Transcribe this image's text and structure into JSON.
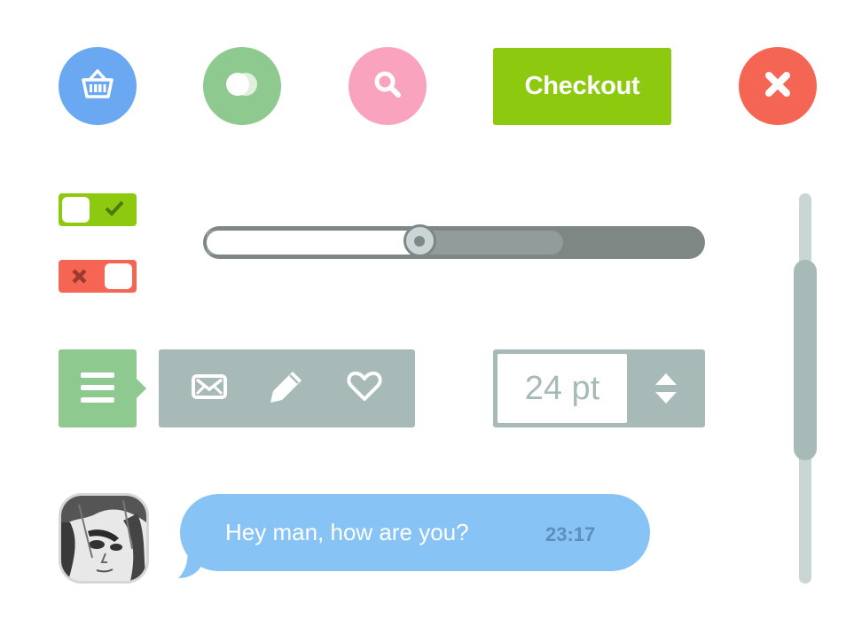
{
  "colors": {
    "blue": "#6aa9f2",
    "green_soft": "#8ec98f",
    "pink": "#f9a3bf",
    "lime": "#8dc90f",
    "red": "#f56554",
    "gray_blue": "#a8bab8",
    "slate": "#7f8785",
    "slate_light": "#929c9a",
    "thumb": "#c9d6d5",
    "bubble": "#88c3f5",
    "bubble_time": "#5b8fbd",
    "stepper_text": "#a8bab8"
  },
  "icons": {
    "basket": "basket-icon",
    "circles": "overlapping-circles-icon",
    "search": "search-icon",
    "close": "close-icon",
    "check": "checkmark-icon",
    "cross": "cross-icon",
    "menu": "hamburger-menu-icon",
    "mail": "envelope-icon",
    "edit": "pencil-icon",
    "like": "heart-icon",
    "stepper": "up-down-arrows-icon"
  },
  "checkout": {
    "label": "Checkout"
  },
  "toggles": {
    "first_on": true,
    "second_on": false
  },
  "slider": {
    "value": 0.43,
    "buffered": 0.72
  },
  "font_size": {
    "value": "24 pt"
  },
  "scrollbar": {
    "position": 0.17,
    "visible_fraction": 0.51
  },
  "chat": {
    "message": "Hey man, how are you?",
    "time": "23:17"
  }
}
